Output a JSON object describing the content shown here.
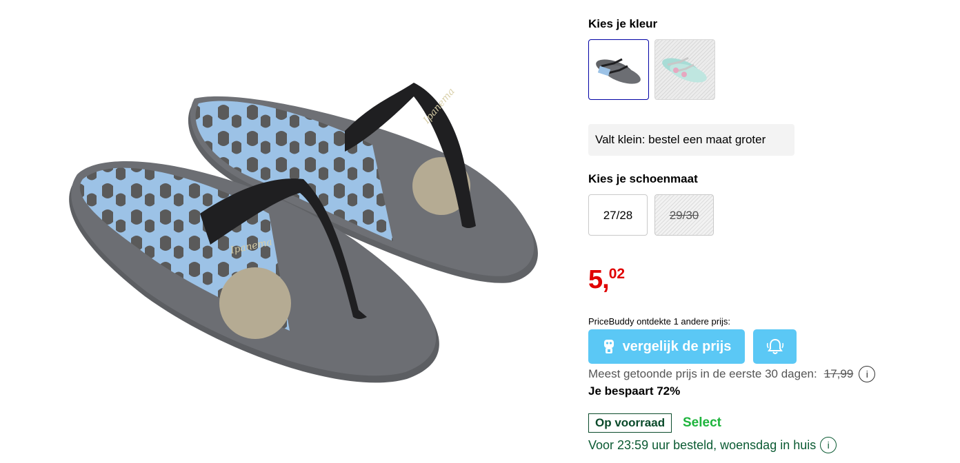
{
  "color_section": {
    "title": "Kies je kleur",
    "swatches": [
      {
        "icon": "flip-flop-grey-thumbnail",
        "selected": true,
        "available": true
      },
      {
        "icon": "flip-flop-mint-thumbnail",
        "selected": false,
        "available": false
      }
    ]
  },
  "fit_note": "Valt klein: bestel een maat groter",
  "size_section": {
    "title": "Kies je schoenmaat",
    "options": [
      {
        "label": "27/28",
        "available": true
      },
      {
        "label": "29/30",
        "available": false
      }
    ]
  },
  "price": {
    "euros": "5,",
    "cents": "02"
  },
  "pricebuddy": {
    "label": "PriceBuddy ontdekte 1 andere prijs:",
    "compare_button": "vergelijk de prijs",
    "bell_icon": "bell-icon"
  },
  "reference_price": {
    "text": "Meest getoonde prijs in de eerste 30 dagen:",
    "old_price": "17,99",
    "info_icon": "i"
  },
  "savings": "Je bespaart 72%",
  "stock": {
    "badge": "Op voorraad",
    "select": "Select"
  },
  "delivery": {
    "text": "Voor 23:59 uur besteld, woensdag in huis",
    "info_icon": "i"
  },
  "colors": {
    "accent": "#0000a4",
    "price": "#e00000",
    "button": "#5bc8f5",
    "select": "#1db43c",
    "stock": "#0a4a2a"
  }
}
